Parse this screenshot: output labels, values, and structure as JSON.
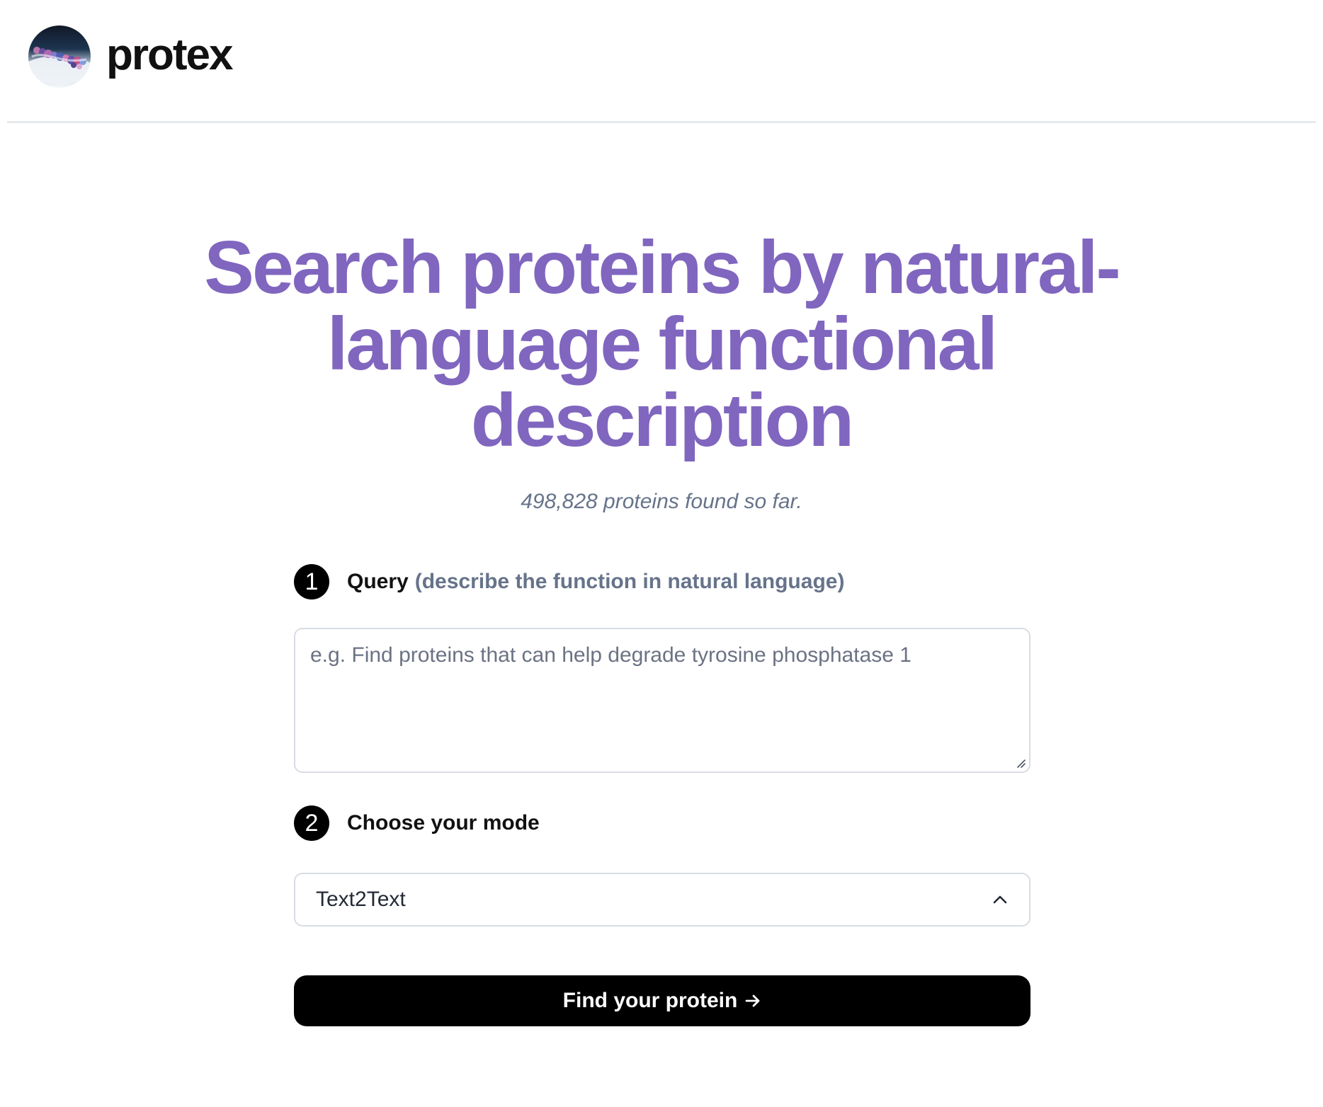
{
  "header": {
    "brand": "protex",
    "logo_icon": "protein-logo-icon"
  },
  "hero": {
    "title": "Search proteins by natural-language functional description",
    "protein_count": "498,828 proteins found so far."
  },
  "form": {
    "step1": {
      "number": "1",
      "label": "Query",
      "hint": "(describe the function in natural language)",
      "placeholder": "e.g. Find proteins that can help degrade tyrosine phosphatase 1",
      "value": ""
    },
    "step2": {
      "number": "2",
      "label": "Choose your mode",
      "selected_mode": "Text2Text",
      "chevron_icon": "chevron-up-icon"
    },
    "submit": {
      "label": "Find your protein",
      "icon": "arrow-right-icon"
    }
  },
  "colors": {
    "accent": "#8066bf",
    "muted_text": "#66738a",
    "button_bg": "#000000",
    "border": "#d8dce3"
  }
}
